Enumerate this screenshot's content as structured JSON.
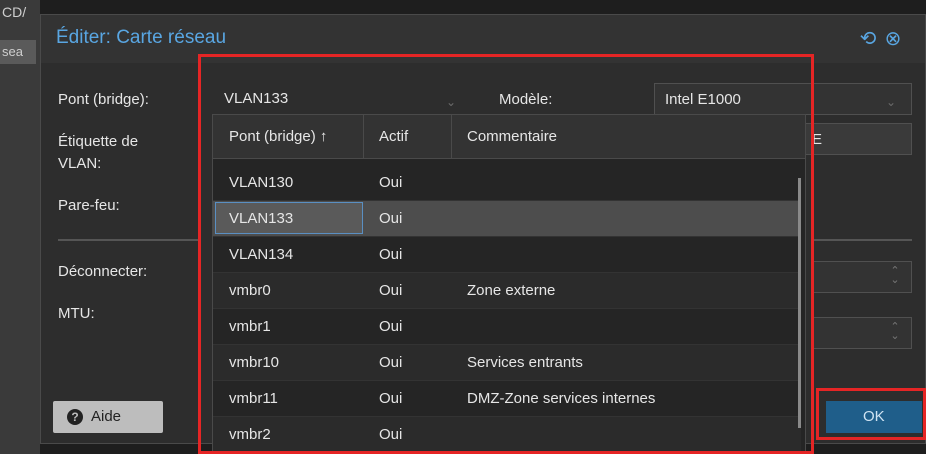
{
  "background": {
    "text_top": "CD/",
    "text_side": "sea"
  },
  "dialog": {
    "title": "Éditer: Carte réseau",
    "reset_icon": "reset-icon",
    "close_icon": "close-icon"
  },
  "form": {
    "bridge_label": "Pont (bridge):",
    "bridge_value": "VLAN133",
    "model_label": "Modèle:",
    "model_value": "Intel E1000",
    "vlan_label": "Étiquette de VLAN:",
    "mac_partial": "E",
    "firewall_label": "Pare-feu:",
    "disconnect_label": "Déconnecter:",
    "mtu_label": "MTU:"
  },
  "dropdown": {
    "columns": [
      "Pont (bridge) ↑",
      "Actif",
      "Commentaire"
    ],
    "rows": [
      {
        "bridge": "VLAN130",
        "active": "Oui",
        "comment": ""
      },
      {
        "bridge": "VLAN133",
        "active": "Oui",
        "comment": ""
      },
      {
        "bridge": "VLAN134",
        "active": "Oui",
        "comment": ""
      },
      {
        "bridge": "vmbr0",
        "active": "Oui",
        "comment": "Zone externe"
      },
      {
        "bridge": "vmbr1",
        "active": "Oui",
        "comment": ""
      },
      {
        "bridge": "vmbr10",
        "active": "Oui",
        "comment": "Services entrants"
      },
      {
        "bridge": "vmbr11",
        "active": "Oui",
        "comment": "DMZ-Zone services internes"
      },
      {
        "bridge": "vmbr2",
        "active": "Oui",
        "comment": ""
      }
    ],
    "selected_bridge": "VLAN133"
  },
  "buttons": {
    "help": "Aide",
    "ok": "OK"
  },
  "colors": {
    "accent": "#59a6e2",
    "highlight": "#e52525",
    "ok_bg": "#1f5e8a"
  }
}
